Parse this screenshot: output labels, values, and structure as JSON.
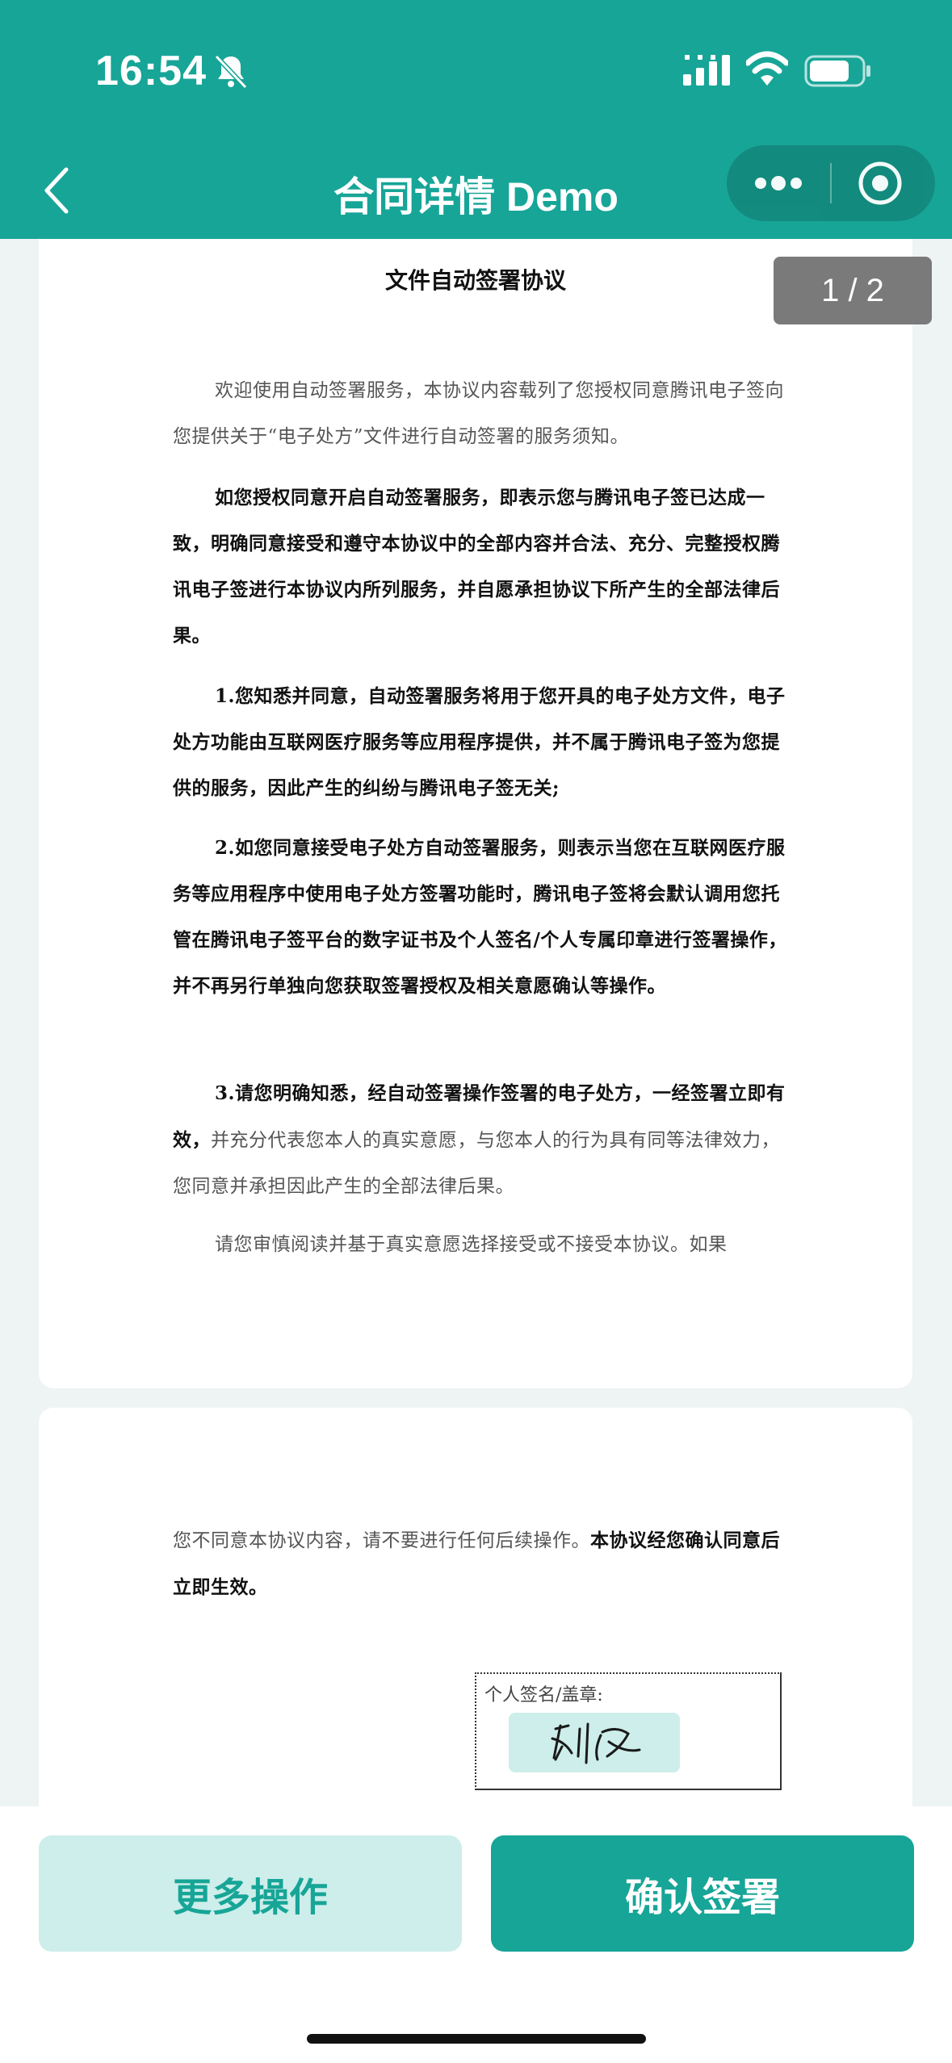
{
  "status_bar": {
    "time": "16:54",
    "icons": [
      "bell-slash-icon",
      "signal-icon",
      "wifi-icon",
      "battery-icon"
    ]
  },
  "nav": {
    "title": "合同详情 Demo",
    "icons": [
      "back-icon",
      "more-icon",
      "close-target-icon"
    ]
  },
  "page_indicator": "1 / 2",
  "document": {
    "title": "文件自动签署协议",
    "paragraphs": [
      {
        "text": "欢迎使用自动签署服务，本协议内容载列了您授权同意腾讯电子签向您提供关于“电子处方”文件进行自动签署的服务须知。",
        "bold": false
      },
      {
        "text": "如您授权同意开启自动签署服务，即表示您与腾讯电子签已达成一致，明确同意接受和遵守本协议中的全部内容并合法、充分、完整授权腾讯电子签进行本协议内所列服务，并自愿承担协议下所产生的全部法律后果。",
        "bold": true
      },
      {
        "text": "1.您知悉并同意，自动签署服务将用于您开具的电子处方文件，电子处方功能由互联网医疗服务等应用程序提供，并不属于腾讯电子签为您提供的服务，因此产生的纠纷与腾讯电子签无关;",
        "bold": true
      },
      {
        "text": "2.如您同意接受电子处方自动签署服务，则表示当您在互联网医疗服务等应用程序中使用电子处方签署功能时，腾讯电子签将会默认调用您托管在腾讯电子签平台的数字证书及个人签名/个人专属印章进行签署操作，并不再另行单独向您获取签署授权及相关意愿确认等操作。",
        "bold": true
      },
      {
        "text_bold": "3.请您明确知悉，经自动签署操作签署的电子处方，一经签署立即有效，",
        "text_normal": "并充分代表您本人的真实意愿，与您本人的行为具有同等法律效力，您同意并承担因此产生的全部法律后果。"
      },
      {
        "text": "请您审慎阅读并基于真实意愿选择接受或不接受本协议。如果",
        "bold": false
      }
    ],
    "page2": {
      "text_normal": "您不同意本协议内容，请不要进行任何后续操作。",
      "text_bold": "本协议经您确认同意后立即生效。",
      "sign_label": "个人签名/盖章:",
      "signature_lettering": "刘俊"
    }
  },
  "footer": {
    "more_label": "更多操作",
    "confirm_label": "确认签署"
  },
  "colors": {
    "primary": "#17a597",
    "light": "#cdeeea"
  }
}
